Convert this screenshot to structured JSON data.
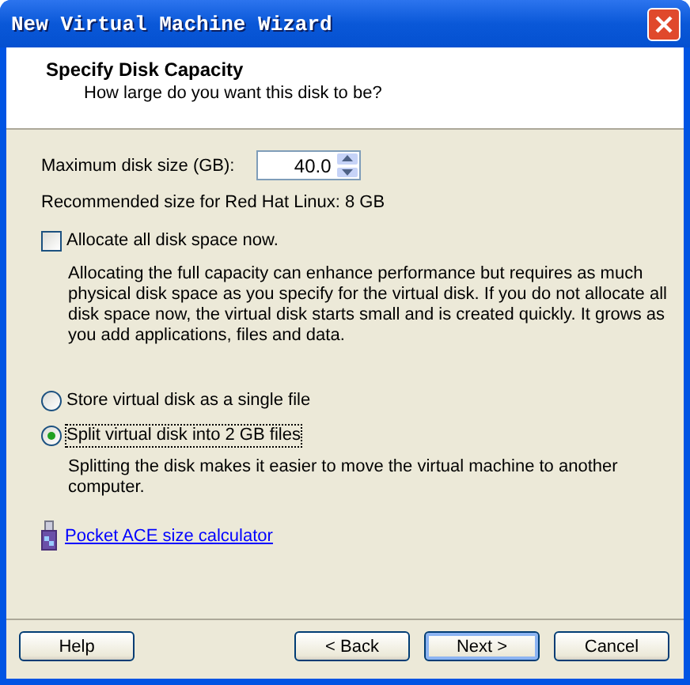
{
  "window": {
    "title": "New Virtual Machine Wizard"
  },
  "header": {
    "title": "Specify Disk Capacity",
    "subtitle": "How large do you want this disk to be?"
  },
  "disk_size": {
    "label": "Maximum disk size (GB):",
    "value": "40.0"
  },
  "recommended": "Recommended size for Red Hat Linux: 8 GB",
  "allocate": {
    "label": "Allocate all disk space now.",
    "checked": false,
    "description": "Allocating the full capacity can enhance performance but requires as much physical disk space as you specify for the virtual disk. If you do not allocate all disk space now, the virtual disk starts small and is created quickly. It grows as you add applications, files and data."
  },
  "storage_options": [
    {
      "label": "Store virtual disk as a single file",
      "selected": false
    },
    {
      "label": "Split virtual disk into 2 GB files",
      "selected": true,
      "description": "Splitting the disk makes it easier to move the virtual machine to another computer."
    }
  ],
  "link": "Pocket ACE size calculator",
  "buttons": [
    {
      "label": "Help",
      "kind": "left"
    },
    {
      "label": "< Back",
      "kind": "right"
    },
    {
      "label": "Next >",
      "kind": "default"
    },
    {
      "label": "Cancel",
      "kind": "right"
    }
  ]
}
